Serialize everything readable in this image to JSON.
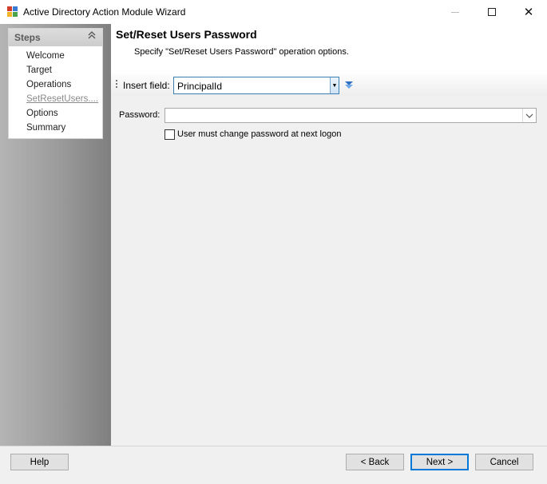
{
  "window": {
    "title": "Active Directory Action Module Wizard",
    "controls": {
      "minimize_icon": "minimize-icon",
      "maximize_icon": "maximize-icon",
      "close_icon": "close-icon",
      "close_glyph": "✕"
    }
  },
  "steps": {
    "title": "Steps",
    "collapse_glyph": "≈",
    "items": [
      {
        "label": "Welcome",
        "state": "done"
      },
      {
        "label": "Target",
        "state": "done"
      },
      {
        "label": "Operations",
        "state": "done"
      },
      {
        "label": "SetResetUsers....",
        "state": "current"
      },
      {
        "label": "Options",
        "state": "pending"
      },
      {
        "label": "Summary",
        "state": "pending"
      }
    ]
  },
  "page": {
    "title": "Set/Reset Users Password",
    "subtitle": "Specify \"Set/Reset Users Password\" operation options."
  },
  "insert_field": {
    "label": "Insert field:",
    "value": "PrincipalId",
    "dropdown_glyph": "▼",
    "insert_glyph": "⏷"
  },
  "form": {
    "password_label": "Password:",
    "password_value": "",
    "password_dropdown_glyph": "⌵",
    "must_change_label": "User must change password at next logon",
    "must_change_checked": false
  },
  "buttons": {
    "help": "Help",
    "back": "< Back",
    "next": "Next >",
    "cancel": "Cancel"
  },
  "colors": {
    "accent": "#0078d7",
    "combo_border": "#3c7fb1",
    "panel_gradient_start": "#b4b4b4",
    "panel_gradient_end": "#7f7f7f",
    "content_bg": "#f0f0f0"
  }
}
